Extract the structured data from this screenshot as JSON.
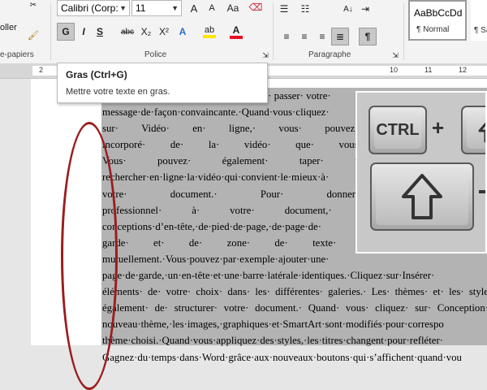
{
  "ribbon": {
    "paste_label": "oller",
    "clipboard_label": "e-papiers",
    "font_name": "Calibri (Corp:",
    "font_size": "11",
    "grow_font": "A",
    "shrink_font": "A",
    "change_case": "Aa",
    "bold": "G",
    "italic": "I",
    "underline": "S",
    "strike": "abc",
    "subscript": "X₂",
    "superscript": "X²",
    "highlight": "ab",
    "font_color": "A",
    "font_group_label": "Police",
    "paragraph_group_label": "Paragraphe",
    "pilcrow": "¶",
    "style_preview": "AaBbCcDd",
    "style_normal": "¶ Normal",
    "style_next": "¶ Sa"
  },
  "ruler": {
    "left_num": "2",
    "ticks": [
      "10",
      "11",
      "12"
    ]
  },
  "tooltip": {
    "title": "Gras (Ctrl+G)",
    "description": "Mettre votre texte en gras."
  },
  "keys": {
    "ctrl": "CTRL",
    "plus": "+"
  },
  "document": {
    "lines": [
      "aire· passer· votre·",
      "message·de·façon·convaincante.·Quand·vous·cliquez·",
      "sur· Vidéo· en· ligne,· vous· pouvez· coller· le· code·",
      "incorporé· de· la· vidéo· que· vous· souhaitez· ajouter.·",
      "Vous· pouvez· également· taper· un· mot-clé· pour·",
      "rechercher·en·ligne·la·vidéo·qui·convient·le·mieux·à·",
      "votre· document.· Pour· donner· un· aspect·",
      "professionnel· à· votre· document,· Word· offre· des·",
      "conceptions·d’en-tête,·de·pied·de·page,·de·page·de·",
      "garde· et· de· zone· de· texte· qui· se· complètent·",
      "mutuellement.·Vous·pouvez·par·exemple·ajouter·une·",
      "page·de·garde,·un·en-tête·et·une·barre·latérale·identiques.·Cliquez·sur·Insérer·",
      "éléments· de· votre· choix· dans· les· différentes· galeries.· Les· thèmes· et· les· style",
      "également· de· structurer· votre· document.· Quand· vous· cliquez· sur· Conception·",
      "nouveau·thème,·les·images,·graphiques·et·SmartArt·sont·modifiés·pour·correspo",
      "thème·choisi.·Quand·vous·appliquez·des·styles,·les·titres·changent·pour·refléter·",
      "Gagnez·du·temps·dans·Word·grâce·aux·nouveaux·boutons·qui·s’affichent·quand·vou"
    ]
  },
  "colors": {
    "annotation": "#9b1c1c",
    "font_color_bar": "#e81123",
    "highlight_bar": "#ffe600"
  }
}
